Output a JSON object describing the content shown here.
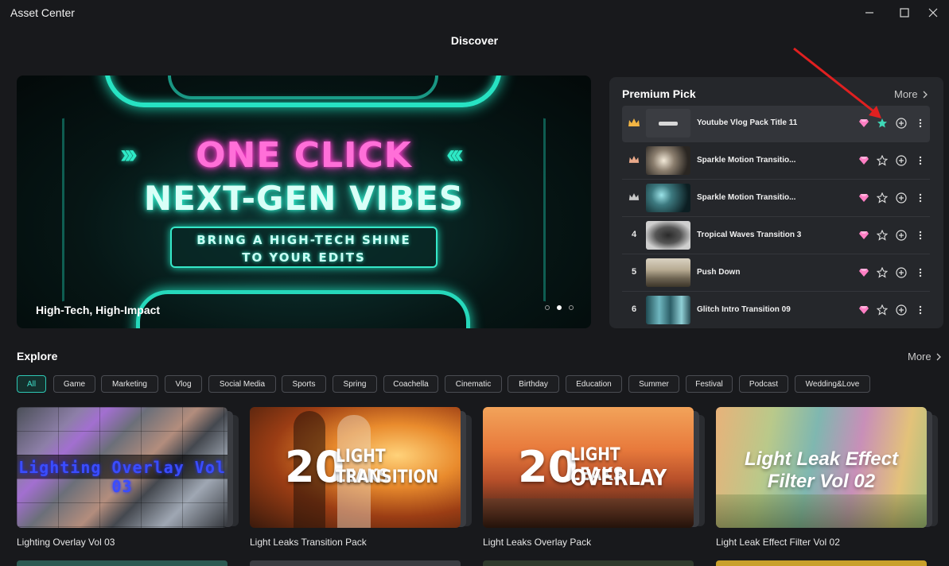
{
  "window": {
    "title": "Asset Center"
  },
  "page": {
    "heading": "Discover"
  },
  "hero": {
    "line1": "ONE CLICK",
    "line2": "NEXT-GEN VIBES",
    "badge_line1": "BRING A HIGH-TECH SHINE",
    "badge_line2": "TO YOUR EDITS",
    "caption": "High-Tech, High-Impact",
    "slides": 3,
    "active_slide": 2
  },
  "premium": {
    "title": "Premium Pick",
    "more": "More",
    "rows": [
      {
        "rank": "1",
        "rank_icon": "crown-gold-icon",
        "title": "Youtube Vlog Pack Title 11",
        "favorited": true
      },
      {
        "rank": "2",
        "rank_icon": "crown-bronze-icon",
        "title": "Sparkle Motion Transitio...",
        "favorited": false
      },
      {
        "rank": "3",
        "rank_icon": "crown-silver-icon",
        "title": "Sparkle Motion Transitio...",
        "favorited": false
      },
      {
        "rank": "4",
        "rank_icon": "",
        "title": "Tropical Waves Transition 3",
        "favorited": false
      },
      {
        "rank": "5",
        "rank_icon": "",
        "title": "Push Down",
        "favorited": false
      },
      {
        "rank": "6",
        "rank_icon": "",
        "title": "Glitch Intro Transition 09",
        "favorited": false
      }
    ]
  },
  "explore": {
    "title": "Explore",
    "more": "More",
    "chips": [
      "All",
      "Game",
      "Marketing",
      "Vlog",
      "Social Media",
      "Sports",
      "Spring",
      "Coachella",
      "Cinematic",
      "Birthday",
      "Education",
      "Summer",
      "Festival",
      "Podcast",
      "Wedding&Love"
    ],
    "active_chip": "All",
    "cards": [
      {
        "label": "Lighting Overlay Vol 03",
        "cover_text": "Lighting Overlay Vol 03"
      },
      {
        "label": "Light Leaks Transition Pack",
        "cover_big": "20",
        "cover_l1": "LIGHT LEAKS",
        "cover_l2": "TRANSITION"
      },
      {
        "label": "Light Leaks Overlay Pack",
        "cover_big": "20",
        "cover_l1": "LIGHT LEAKS",
        "cover_l2": "OVERLAY"
      },
      {
        "label": "Light Leak Effect Filter Vol 02",
        "cover_l1": "Light Leak Effect",
        "cover_l2": "Filter Vol 02"
      }
    ]
  },
  "colors": {
    "accent": "#2ec7b4",
    "gem": "#ff7fc4",
    "star_active": "#3fd8b7",
    "annotation_arrow": "#e02020"
  }
}
